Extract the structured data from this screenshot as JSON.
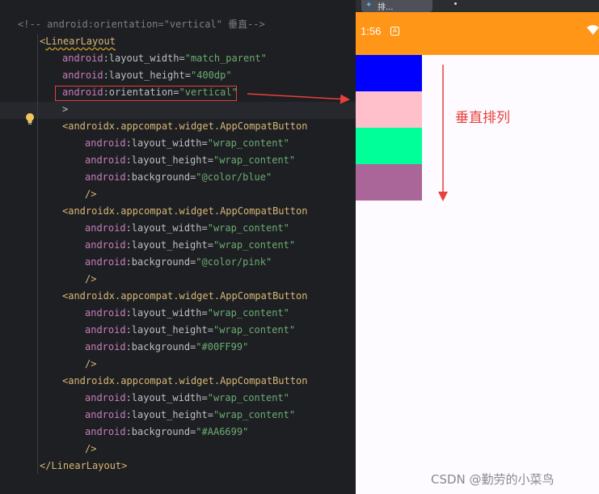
{
  "editor": {
    "lines": [
      {
        "id": "l1",
        "parts": [
          {
            "c": "comment",
            "t": "<!-- android:orientation=\"vertical\" 垂直-->"
          }
        ]
      },
      {
        "id": "l2",
        "parts": [
          {
            "c": "tag",
            "t": "<"
          },
          {
            "c": "tag squiggle",
            "t": "LinearLayout"
          }
        ]
      },
      {
        "id": "l3",
        "parts": [
          {
            "c": "attrns",
            "t": "android"
          },
          {
            "c": "attr",
            "t": ":layout_width"
          },
          {
            "c": "eq",
            "t": "="
          },
          {
            "c": "str",
            "t": "\"match_parent\""
          }
        ]
      },
      {
        "id": "l4",
        "parts": [
          {
            "c": "attrns",
            "t": "android"
          },
          {
            "c": "attr",
            "t": ":layout_height"
          },
          {
            "c": "eq",
            "t": "="
          },
          {
            "c": "str",
            "t": "\"400dp\""
          }
        ]
      },
      {
        "id": "l5",
        "parts": [
          {
            "c": "attrns",
            "t": "android"
          },
          {
            "c": "attr",
            "t": ":orientation"
          },
          {
            "c": "eq",
            "t": "="
          },
          {
            "c": "str",
            "t": "\"vertical\""
          }
        ]
      },
      {
        "id": "l6",
        "parts": [
          {
            "c": "plain",
            "t": ">"
          }
        ]
      },
      {
        "id": "l7",
        "parts": [
          {
            "c": "tag",
            "t": "<androidx.appcompat.widget.AppCompatButton"
          }
        ]
      },
      {
        "id": "l8",
        "parts": [
          {
            "c": "attrns",
            "t": "android"
          },
          {
            "c": "attr",
            "t": ":layout_width"
          },
          {
            "c": "eq",
            "t": "="
          },
          {
            "c": "str",
            "t": "\"wrap_content\""
          }
        ]
      },
      {
        "id": "l9",
        "parts": [
          {
            "c": "attrns",
            "t": "android"
          },
          {
            "c": "attr",
            "t": ":layout_height"
          },
          {
            "c": "eq",
            "t": "="
          },
          {
            "c": "str",
            "t": "\"wrap_content\""
          }
        ]
      },
      {
        "id": "l10",
        "parts": [
          {
            "c": "attrns",
            "t": "android"
          },
          {
            "c": "attr",
            "t": ":background"
          },
          {
            "c": "eq",
            "t": "="
          },
          {
            "c": "str",
            "t": "\"@color/blue\""
          }
        ]
      },
      {
        "id": "l11",
        "parts": [
          {
            "c": "tag",
            "t": "/>"
          }
        ]
      },
      {
        "id": "l12",
        "parts": [
          {
            "c": "tag",
            "t": "<androidx.appcompat.widget.AppCompatButton"
          }
        ]
      },
      {
        "id": "l13",
        "parts": [
          {
            "c": "attrns",
            "t": "android"
          },
          {
            "c": "attr",
            "t": ":layout_width"
          },
          {
            "c": "eq",
            "t": "="
          },
          {
            "c": "str",
            "t": "\"wrap_content\""
          }
        ]
      },
      {
        "id": "l14",
        "parts": [
          {
            "c": "attrns",
            "t": "android"
          },
          {
            "c": "attr",
            "t": ":layout_height"
          },
          {
            "c": "eq",
            "t": "="
          },
          {
            "c": "str",
            "t": "\"wrap_content\""
          }
        ]
      },
      {
        "id": "l15",
        "parts": [
          {
            "c": "attrns",
            "t": "android"
          },
          {
            "c": "attr",
            "t": ":background"
          },
          {
            "c": "eq",
            "t": "="
          },
          {
            "c": "str",
            "t": "\"@color/pink\""
          }
        ]
      },
      {
        "id": "l16",
        "parts": [
          {
            "c": "tag",
            "t": "/>"
          }
        ]
      },
      {
        "id": "l17",
        "parts": [
          {
            "c": "tag",
            "t": "<androidx.appcompat.widget.AppCompatButton"
          }
        ]
      },
      {
        "id": "l18",
        "parts": [
          {
            "c": "attrns",
            "t": "android"
          },
          {
            "c": "attr",
            "t": ":layout_width"
          },
          {
            "c": "eq",
            "t": "="
          },
          {
            "c": "str",
            "t": "\"wrap_content\""
          }
        ]
      },
      {
        "id": "l19",
        "parts": [
          {
            "c": "attrns",
            "t": "android"
          },
          {
            "c": "attr",
            "t": ":layout_height"
          },
          {
            "c": "eq",
            "t": "="
          },
          {
            "c": "str",
            "t": "\"wrap_content\""
          }
        ]
      },
      {
        "id": "l20",
        "parts": [
          {
            "c": "attrns",
            "t": "android"
          },
          {
            "c": "attr",
            "t": ":background"
          },
          {
            "c": "eq",
            "t": "="
          },
          {
            "c": "str",
            "t": "\"#00FF99\""
          }
        ]
      },
      {
        "id": "l21",
        "parts": [
          {
            "c": "tag",
            "t": "/>"
          }
        ]
      },
      {
        "id": "l22",
        "parts": [
          {
            "c": "tag",
            "t": "<androidx.appcompat.widget.AppCompatButton"
          }
        ]
      },
      {
        "id": "l23",
        "parts": [
          {
            "c": "attrns",
            "t": "android"
          },
          {
            "c": "attr",
            "t": ":layout_width"
          },
          {
            "c": "eq",
            "t": "="
          },
          {
            "c": "str",
            "t": "\"wrap_content\""
          }
        ]
      },
      {
        "id": "l24",
        "parts": [
          {
            "c": "attrns",
            "t": "android"
          },
          {
            "c": "attr",
            "t": ":layout_height"
          },
          {
            "c": "eq",
            "t": "="
          },
          {
            "c": "str",
            "t": "\"wrap_content\""
          }
        ]
      },
      {
        "id": "l25",
        "parts": [
          {
            "c": "attrns",
            "t": "android"
          },
          {
            "c": "attr",
            "t": ":background"
          },
          {
            "c": "eq",
            "t": "="
          },
          {
            "c": "str",
            "t": "\"#AA6699\""
          }
        ]
      },
      {
        "id": "l26",
        "parts": [
          {
            "c": "tag",
            "t": "/>"
          }
        ]
      },
      {
        "id": "l27",
        "parts": [
          {
            "c": "tag",
            "t": "</LinearLayout>"
          }
        ]
      }
    ],
    "gutter_icon": "lightbulb-icon"
  },
  "device": {
    "tab_label": "排...",
    "time": "1:56",
    "status_icon_letter": "A",
    "wifi_icon": "wifi-icon",
    "status_color": "#FF9618",
    "buttons": [
      {
        "name": "blue-button",
        "color": "#0000FF"
      },
      {
        "name": "pink-button",
        "color": "#FFC0CB"
      },
      {
        "name": "green-button",
        "color": "#00FF99"
      },
      {
        "name": "purple-button",
        "color": "#AA6699"
      }
    ]
  },
  "annotation": {
    "note": "垂直排列",
    "accent": "#E8403A"
  },
  "watermark": "CSDN @勤劳的小菜鸟"
}
